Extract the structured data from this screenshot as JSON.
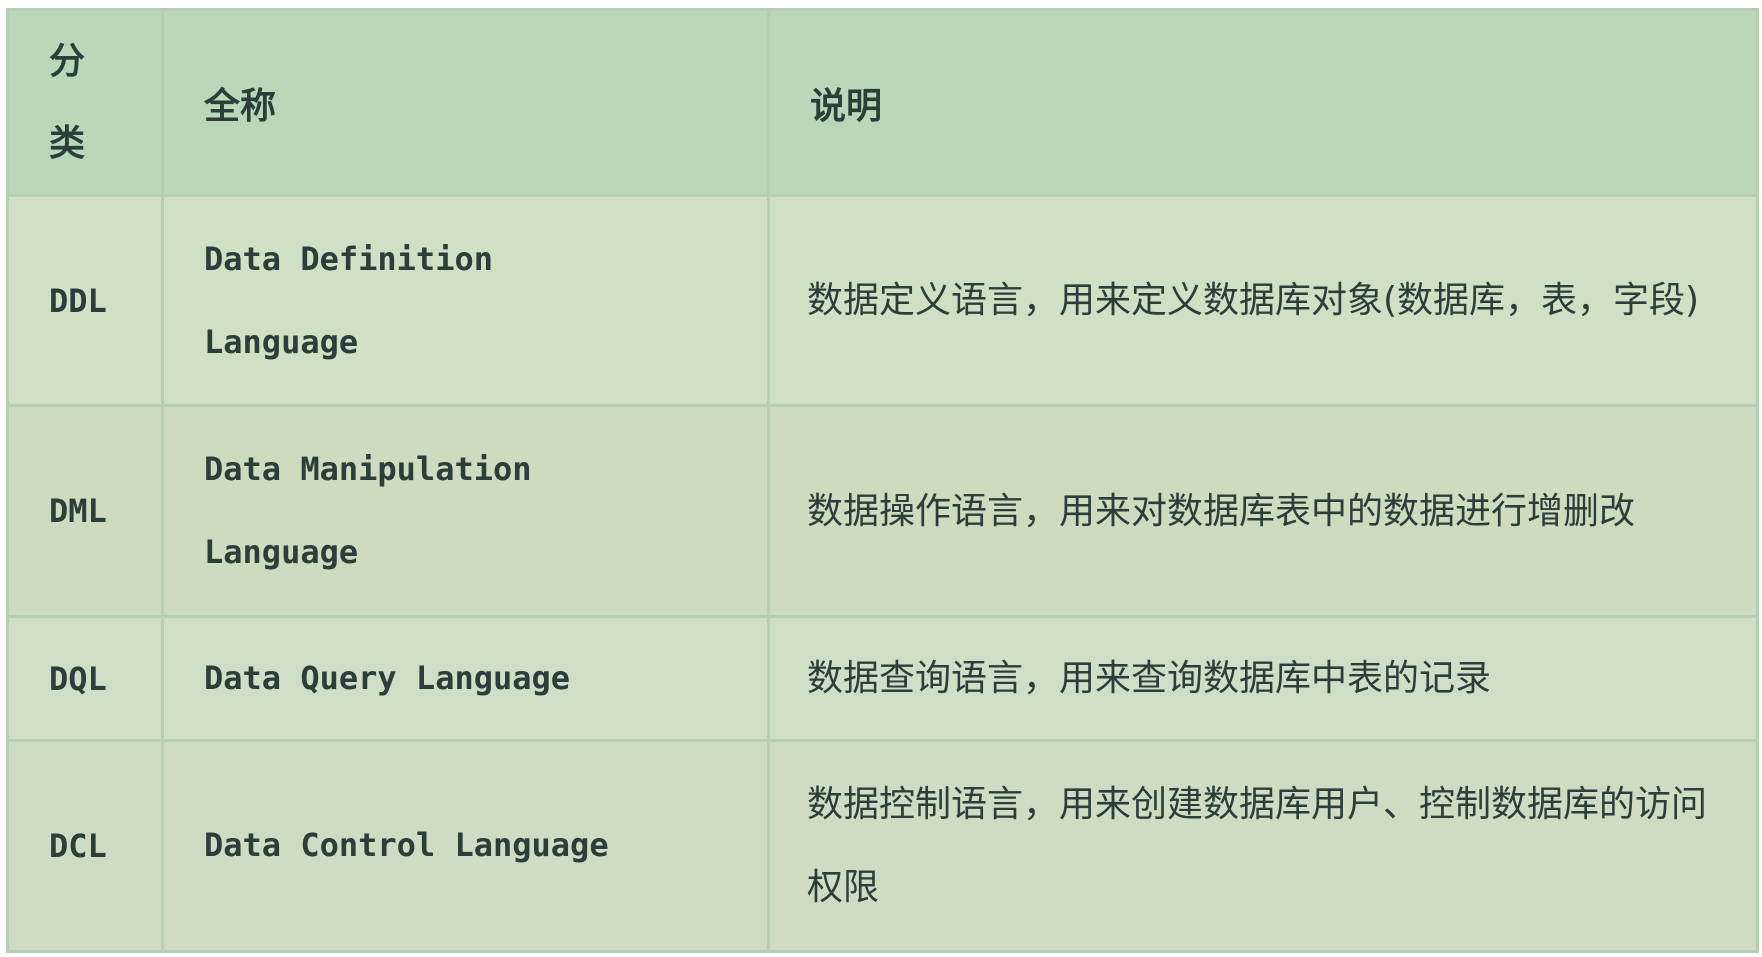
{
  "table": {
    "headers": {
      "category_chars": [
        "分",
        "类"
      ],
      "full_name": "全称",
      "description": "说明"
    },
    "rows": [
      {
        "category": "DDL",
        "full_name_lines": [
          "Data Definition",
          "Language"
        ],
        "description": "数据定义语言，用来定义数据库对象(数据库，表，字段)"
      },
      {
        "category": "DML",
        "full_name_lines": [
          "Data Manipulation",
          "Language"
        ],
        "description": "数据操作语言，用来对数据库表中的数据进行增删改"
      },
      {
        "category": "DQL",
        "full_name_lines": [
          "Data Query Language"
        ],
        "description": "数据查询语言，用来查询数据库中表的记录"
      },
      {
        "category": "DCL",
        "full_name_lines": [
          "Data Control Language"
        ],
        "description": "数据控制语言，用来创建数据库用户、控制数据库的访问权限"
      }
    ]
  },
  "colors": {
    "header_bg": "#b9d8b9",
    "border": "#b6ceb4",
    "text": "#2c3e3a"
  }
}
